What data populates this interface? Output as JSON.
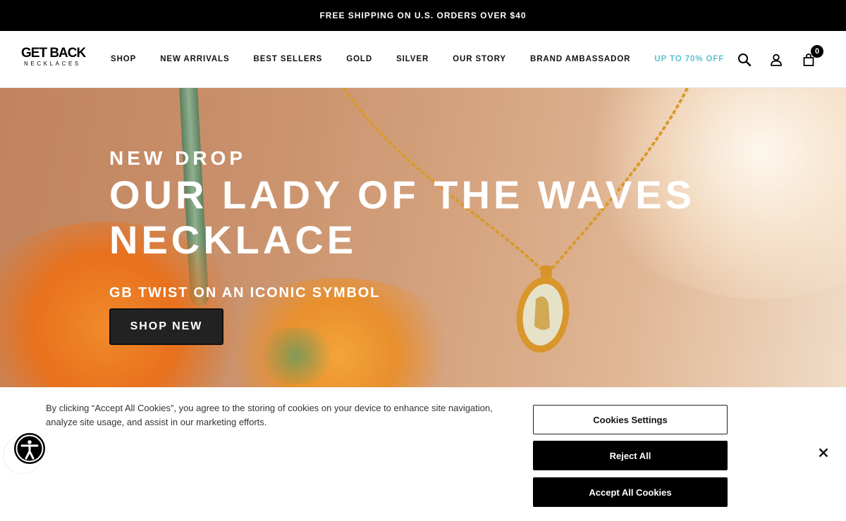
{
  "announcement": {
    "text": "FREE SHIPPING ON U.S. ORDERS OVER $40"
  },
  "header": {
    "logo": {
      "line1": "GET BACK",
      "line2": "NECKLACES"
    },
    "nav": [
      {
        "label": "SHOP"
      },
      {
        "label": "NEW ARRIVALS"
      },
      {
        "label": "BEST SELLERS"
      },
      {
        "label": "GOLD"
      },
      {
        "label": "SILVER"
      },
      {
        "label": "OUR STORY"
      },
      {
        "label": "BRAND AMBASSADOR"
      },
      {
        "label": "UP TO 70% OFF",
        "accent_color": "#5cc3cf"
      }
    ],
    "icons": [
      "search-icon",
      "account-icon",
      "bag-icon"
    ],
    "cart_count": "0"
  },
  "hero": {
    "kicker": "NEW DROP",
    "title_line1": "OUR LADY OF THE WAVES",
    "title_line2": "NECKLACE",
    "subtitle": "GB TWIST ON AN ICONIC SYMBOL",
    "cta": "SHOP NEW"
  },
  "cookie_banner": {
    "message": "By clicking “Accept All Cookies”, you agree to the storing of cookies on your device to enhance site navigation, analyze site usage, and assist in our marketing efforts.",
    "settings_label": "Cookies Settings",
    "reject_label": "Reject All",
    "accept_label": "Accept All Cookies"
  },
  "colors": {
    "accent": "#5cc3cf",
    "announcement_bg": "#000000",
    "cta_bg": "#222222"
  }
}
